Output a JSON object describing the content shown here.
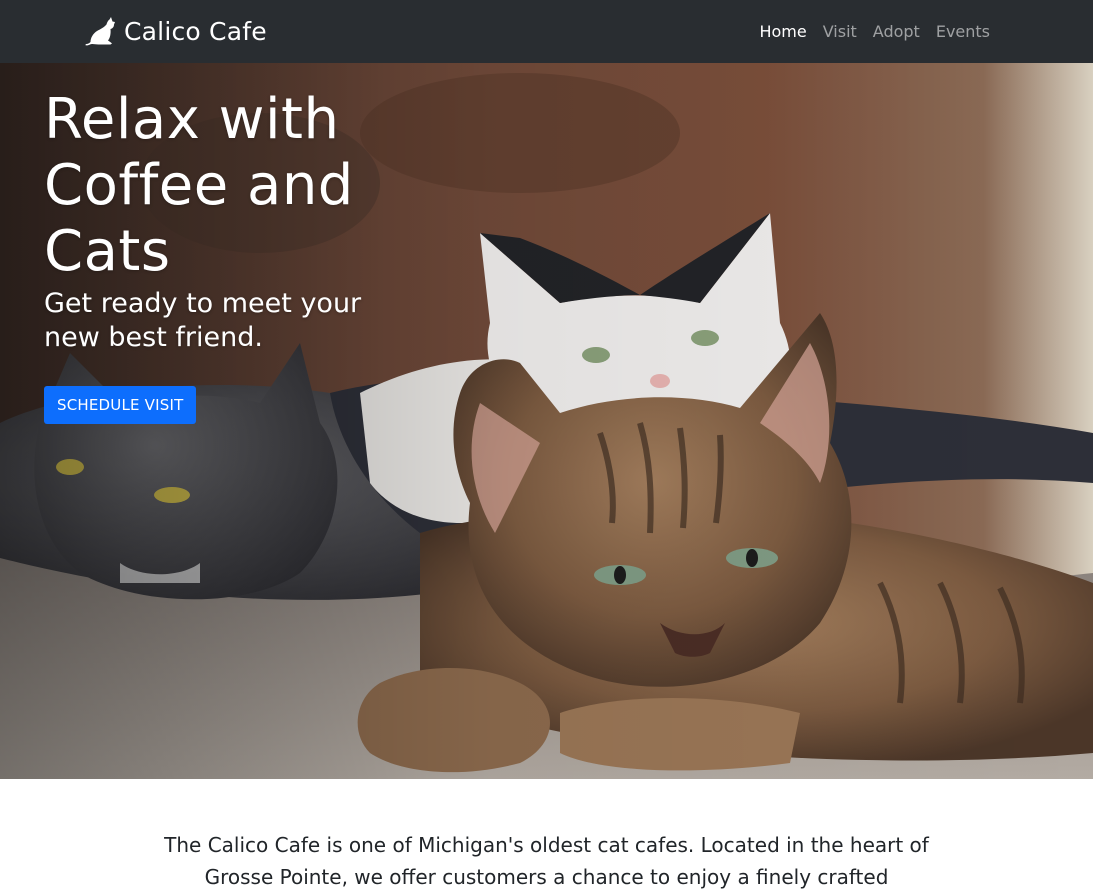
{
  "navbar": {
    "brand": "Calico Cafe",
    "brand_icon": "cat-icon",
    "links": [
      {
        "label": "Home",
        "active": true
      },
      {
        "label": "Visit",
        "active": false
      },
      {
        "label": "Adopt",
        "active": false
      },
      {
        "label": "Events",
        "active": false
      }
    ]
  },
  "hero": {
    "title": "Relax with Coffee and Cats",
    "subtitle": "Get ready to meet your new best friend.",
    "cta_label": "SCHEDULE VISIT"
  },
  "about": {
    "text": "The Calico Cafe is one of Michigan's oldest cat cafes. Located in the heart of Grosse Pointe, we offer customers a chance to enjoy a finely crafted"
  },
  "colors": {
    "navbar_bg": "#292d31",
    "accent": "#0d6efd"
  }
}
